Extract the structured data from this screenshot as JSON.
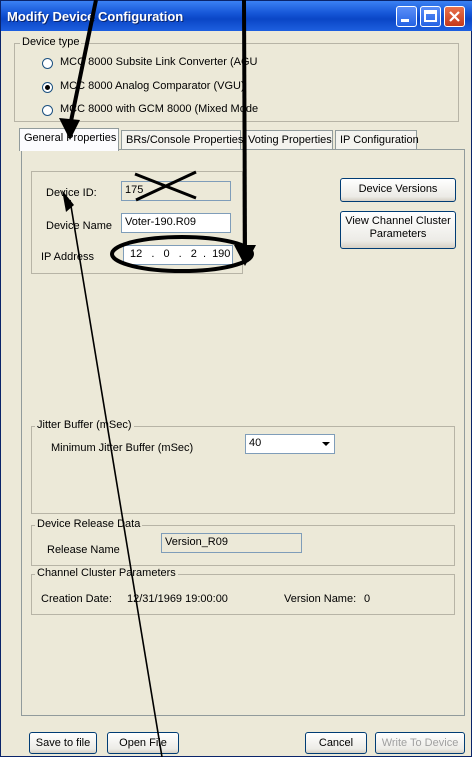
{
  "window": {
    "title": "Modify Device Configuration"
  },
  "device_type": {
    "label": "Device type",
    "options": [
      {
        "label": "MCC 8000 Subsite Link Converter (AGU",
        "selected": false
      },
      {
        "label": "MCC 8000 Analog Comparator (VGU)",
        "selected": true
      },
      {
        "label": "MCC 8000 with GCM 8000 (Mixed Mode",
        "selected": false
      }
    ]
  },
  "tabs": [
    {
      "label": "General Properties",
      "active": true
    },
    {
      "label": "BRs/Console Properties",
      "active": false
    },
    {
      "label": "Voting Properties",
      "active": false
    },
    {
      "label": "IP Configuration",
      "active": false
    }
  ],
  "general": {
    "device_id_label": "Device ID:",
    "device_id_value": "175",
    "device_name_label": "Device Name",
    "device_name_value": "Voter-190.R09",
    "ip_label": "IP Address",
    "ip_octets": [
      "12",
      "0",
      "2",
      "190"
    ],
    "device_versions_button": "Device Versions",
    "view_channel_button": "View Channel Cluster Parameters"
  },
  "jitter": {
    "label": "Jitter Buffer (mSec)",
    "min_label": "Minimum Jitter Buffer (mSec)",
    "min_value": "40"
  },
  "release": {
    "label": "Device Release Data",
    "name_label": "Release Name",
    "name_value": "Version_R09"
  },
  "cluster": {
    "label": "Channel Cluster Parameters",
    "creation_label": "Creation Date:",
    "creation_value": "12/31/1969 19:00:00",
    "version_label": "Version Name:",
    "version_value": "0"
  },
  "footer": {
    "save": "Save to file",
    "open": "Open File",
    "cancel": "Cancel",
    "write": "Write To Device"
  },
  "colors": {
    "titlebar": "#1657d8",
    "dialog_bg": "#ece9d8",
    "annotation": "#000000"
  }
}
